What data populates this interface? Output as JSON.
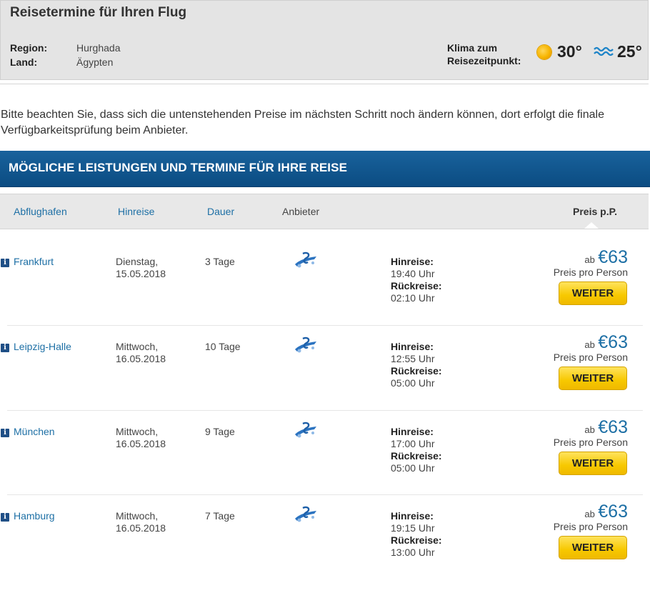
{
  "header": {
    "title": "Reisetermine für Ihren Flug",
    "region_label": "Region:",
    "region_value": "Hurghada",
    "country_label": "Land:",
    "country_value": "Ägypten",
    "climate_label_line1": "Klima zum",
    "climate_label_line2": "Reisezeitpunkt:",
    "air_temp": "30°",
    "water_temp": "25°",
    "icons": {
      "air": "sun-icon",
      "water": "waves-icon"
    }
  },
  "notice": "Bitte beachten Sie, dass sich die untenstehenden Preise im nächsten Schritt noch ändern können, dort erfolgt die finale Verfügbarkeitsprüfung beim Anbieter.",
  "section_title": "MÖGLICHE LEISTUNGEN UND TERMINE FÜR IHRE REISE",
  "columns": {
    "airport": "Abflughafen",
    "outbound": "Hinreise",
    "duration": "Dauer",
    "provider": "Anbieter",
    "price": "Preis p.P."
  },
  "labels": {
    "outbound": "Hinreise:",
    "return": "Rückreise:",
    "price_prefix": "ab",
    "per_person": "Preis pro Person",
    "button": "WEITER"
  },
  "flights": [
    {
      "airport": "Frankfurt",
      "weekday": "Dienstag,",
      "date": "15.05.2018",
      "duration": "3 Tage",
      "out_time": "19:40 Uhr",
      "ret_time": "02:10 Uhr",
      "price": "€63"
    },
    {
      "airport": "Leipzig-Halle",
      "weekday": "Mittwoch,",
      "date": "16.05.2018",
      "duration": "10 Tage",
      "out_time": "12:55 Uhr",
      "ret_time": "05:00 Uhr",
      "price": "€63"
    },
    {
      "airport": "München",
      "weekday": "Mittwoch,",
      "date": "16.05.2018",
      "duration": "9 Tage",
      "out_time": "17:00 Uhr",
      "ret_time": "05:00 Uhr",
      "price": "€63"
    },
    {
      "airport": "Hamburg",
      "weekday": "Mittwoch,",
      "date": "16.05.2018",
      "duration": "7 Tage",
      "out_time": "19:15 Uhr",
      "ret_time": "13:00 Uhr",
      "price": "€63"
    }
  ],
  "colors": {
    "header_bg": "#e4e4e4",
    "section_bar": "#0b4c82",
    "link": "#1d6fa5",
    "button": "#f7c800"
  }
}
